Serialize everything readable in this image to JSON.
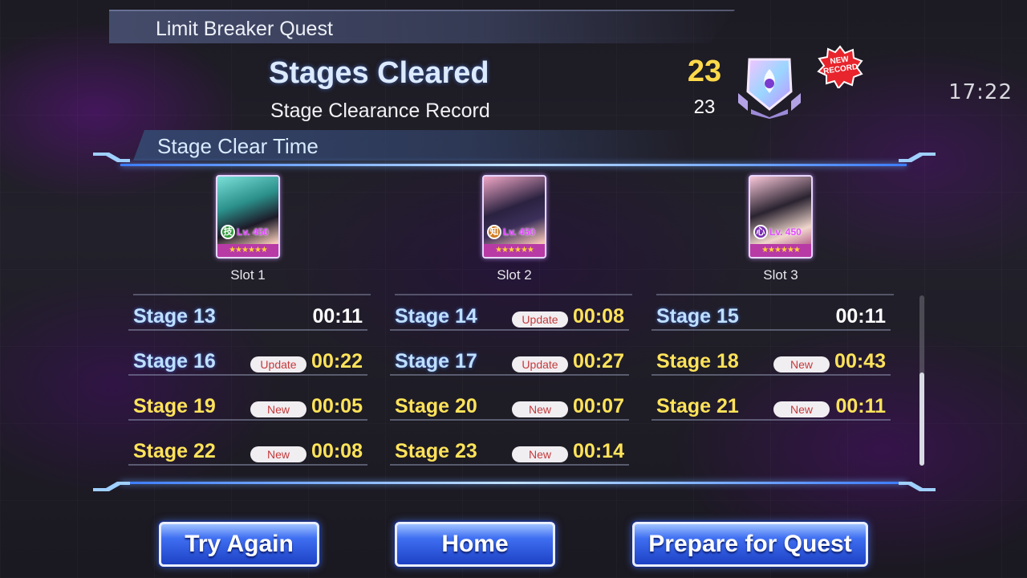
{
  "status_bar": {
    "time": "17:22"
  },
  "header": {
    "quest_title": "Limit Breaker Quest",
    "stages_cleared_label": "Stages Cleared",
    "stage_clearance_record_label": "Stage Clearance Record",
    "stages_cleared_value": "23",
    "record_value": "23",
    "new_record_badge": "NEW RECORD",
    "accent_color": "#ffd94a"
  },
  "section": {
    "title": "Stage Clear Time"
  },
  "slots": [
    {
      "label": "Slot 1",
      "level": "Lv. 450",
      "emblem": "技",
      "emblem_color": "#2f9a3a",
      "stars": "★★★★★★"
    },
    {
      "label": "Slot 2",
      "level": "Lv. 450",
      "emblem": "知",
      "emblem_color": "#d07a1f",
      "stars": "★★★★★★"
    },
    {
      "label": "Slot 3",
      "level": "Lv. 450",
      "emblem": "心",
      "emblem_color": "#7a2fb0",
      "stars": "★★★★★★"
    }
  ],
  "stages": [
    {
      "name": "Stage 13",
      "badge": "",
      "time": "00:11",
      "name_color": "blue",
      "time_color": "white"
    },
    {
      "name": "Stage 14",
      "badge": "Update",
      "time": "00:08",
      "name_color": "blue",
      "time_color": "yellow"
    },
    {
      "name": "Stage 15",
      "badge": "",
      "time": "00:11",
      "name_color": "blue",
      "time_color": "white"
    },
    {
      "name": "Stage 16",
      "badge": "Update",
      "time": "00:22",
      "name_color": "blue",
      "time_color": "yellow"
    },
    {
      "name": "Stage 17",
      "badge": "Update",
      "time": "00:27",
      "name_color": "blue",
      "time_color": "yellow"
    },
    {
      "name": "Stage 18",
      "badge": "New",
      "time": "00:43",
      "name_color": "yellow",
      "time_color": "yellow"
    },
    {
      "name": "Stage 19",
      "badge": "New",
      "time": "00:05",
      "name_color": "yellow",
      "time_color": "yellow"
    },
    {
      "name": "Stage 20",
      "badge": "New",
      "time": "00:07",
      "name_color": "yellow",
      "time_color": "yellow"
    },
    {
      "name": "Stage 21",
      "badge": "New",
      "time": "00:11",
      "name_color": "yellow",
      "time_color": "yellow"
    },
    {
      "name": "Stage 22",
      "badge": "New",
      "time": "00:08",
      "name_color": "yellow",
      "time_color": "yellow"
    },
    {
      "name": "Stage 23",
      "badge": "New",
      "time": "00:14",
      "name_color": "yellow",
      "time_color": "yellow"
    }
  ],
  "buttons": {
    "try_again": "Try Again",
    "home": "Home",
    "prepare": "Prepare for Quest"
  }
}
